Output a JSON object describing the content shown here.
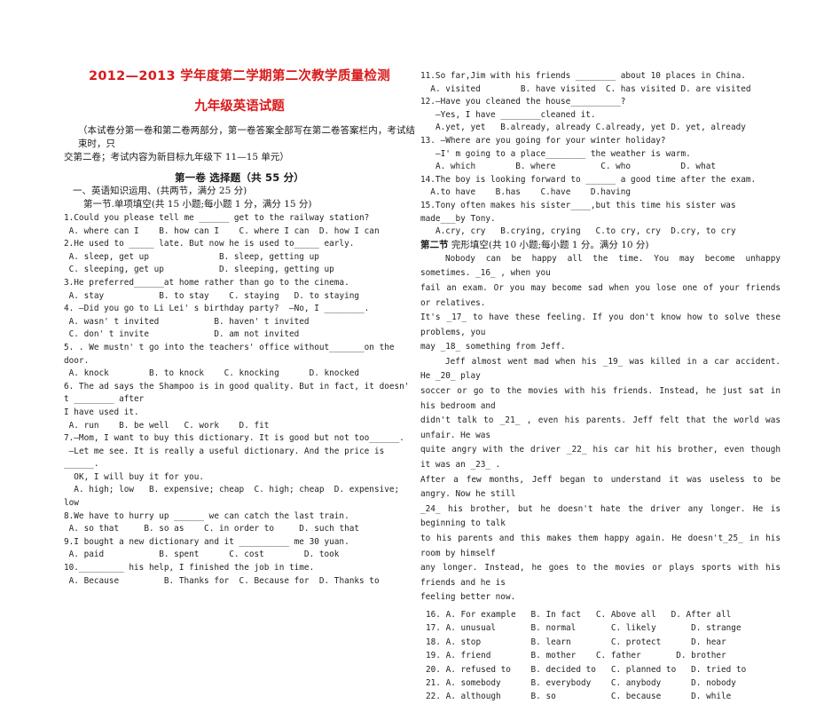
{
  "document": {
    "title_main": "2012—2013 学年度第二学期第二次教学质量检测",
    "title_sub": "九年级英语试题",
    "notice_line1": "（本试卷分第一卷和第二卷两部分，第一卷答案全部写在第二卷答案栏内，考试结束时，只",
    "notice_line2": "交第二卷；考试内容为新目标九年级下 11—15 单元）",
    "paper_section": "第一卷 选择题（共 55 分）",
    "part_one": "一、英语知识运用、(共两节，满分 25 分)",
    "section_one": "第一节.单项填空(共 15 小题;每小题 1 分，满分 15 分)",
    "section_two_label": "第二节",
    "section_two": "完形填空(共 10 小题;每小题 1 分。满分 10 分)"
  },
  "left_column": {
    "questions": [
      {
        "lines": [
          "1.Could you please tell me ______ get to the railway station?",
          " A. where can I    B. how can I    C. where I can  D. how I can"
        ]
      },
      {
        "lines": [
          "2.He used to _____ late. But now he is used to_____ early.",
          " A. sleep, get up              B. sleep, getting up",
          " C. sleeping, get up           D. sleeping, getting up"
        ]
      },
      {
        "lines": [
          "3.He preferred______at home rather than go to the cinema.",
          " A. stay           B. to stay    C. staying   D. to staying"
        ]
      },
      {
        "lines": [
          "4. —Did you go to Li Lei' s birthday party?  —No, I ________.",
          " A. wasn' t invited           B. haven' t invited",
          " C. don' t invite             D. am not invited"
        ]
      },
      {
        "lines": [
          "5. . We mustn' t go into the teachers' office without_______on the door.",
          " A. knock        B. to knock    C. knocking      D. knocked"
        ]
      },
      {
        "lines": [
          "6. The ad says the Shampoo is in good quality. But in fact, it doesn' t ________ after",
          "I have used it.",
          " A. run    B. be well   C. work    D. fit"
        ]
      },
      {
        "lines": [
          "7.—Mom, I want to buy this dictionary. It is good but not too______.",
          " —Let me see. It is really a useful dictionary. And the price is ______.",
          "  OK, I will buy it for you.",
          "  A. high; low   B. expensive; cheap  C. high; cheap  D. expensive; low"
        ]
      },
      {
        "lines": [
          "8.We have to hurry up ______ we can catch the last train.",
          " A. so that     B. so as    C. in order to     D. such that"
        ]
      },
      {
        "lines": [
          "9.I bought a new dictionary and it __________ me 30 yuan.",
          " A. paid           B. spent      C. cost        D. took"
        ]
      },
      {
        "lines": [
          "10._________ his help, I finished the job in time.",
          " A. Because         B. Thanks for  C. Because for  D. Thanks to"
        ]
      }
    ]
  },
  "right_column": {
    "questions": [
      {
        "lines": [
          "11.So far,Jim with his friends ________ about 10 places in China.",
          "  A. visited        B. have visited  C. has visited D. are visited"
        ]
      },
      {
        "lines": [
          "12.—Have you cleaned the house__________?",
          "   —Yes, I have ________cleaned it.",
          "   A.yet, yet   B.already, already C.already, yet D. yet, already"
        ]
      },
      {
        "lines": [
          "13. —Where are you going for your winter holiday?",
          "   —I' m going to a place________ the weather is warm.",
          "   A. which        B. where         C. who          D. what"
        ]
      },
      {
        "lines": [
          "14.The boy is looking forward to ______ a good time after the exam.",
          "  A.to have    B.has    C.have    D.having"
        ]
      },
      {
        "lines": [
          "15.Tony often makes his sister____,but this time his sister was made___by Tony.",
          "   A.cry, cry   B.crying, crying   C.to cry, cry  D.cry, to cry"
        ]
      }
    ],
    "cloze_passage": [
      {
        "indent": true,
        "text": "Nobody can be happy all the time. You may become unhappy sometimes. _16_ , when you"
      },
      {
        "indent": false,
        "text": "fail an exam. Or you may become sad when you lose one of your friends or relatives."
      },
      {
        "indent": false,
        "text": "It's _17_  to have these feeling. If you don't know how to solve these problems, you"
      },
      {
        "indent": false,
        "text": "may _18_  something from Jeff."
      },
      {
        "indent": true,
        "text": "Jeff almost went mad when his _19_  was killed in a car accident. He _20_  play"
      },
      {
        "indent": false,
        "text": "soccer or go to the movies with his friends. Instead, he just sat in his bedroom and"
      },
      {
        "indent": false,
        "text": "didn't talk to _21_  , even his parents. Jeff felt that the world was unfair. He was"
      },
      {
        "indent": false,
        "text": "quite angry with the driver _22_   his car hit his brother, even though it was an _23_  ."
      },
      {
        "indent": false,
        "text": "After a few months, Jeff began to understand it was useless to be angry. Now he still"
      },
      {
        "indent": false,
        "text": "_24_   his brother, but he doesn't hate the driver any longer. He is beginning to talk"
      },
      {
        "indent": false,
        "text": "to his parents and this makes them happy again. He doesn't_25_   in his room by himself"
      },
      {
        "indent": false,
        "text": "any longer. Instead, he goes to the movies or plays sports with his friends and he is"
      },
      {
        "indent": false,
        "text": "feeling better now."
      }
    ],
    "cloze_options": [
      "16. A. For example   B. In fact   C. Above all   D. After all",
      "17. A. unusual       B. normal       C. likely       D. strange",
      "18. A. stop          B. learn        C. protect      D. hear",
      "19. A. friend        B. mother    C. father       D. brother",
      "20. A. refused to    B. decided to   C. planned to   D. tried to",
      "21. A. somebody      B. everybody    C. anybody      D. nobody",
      "22. A. although      B. so           C. because      D. while"
    ]
  },
  "colors": {
    "title_red": "#d91b1b",
    "body_text": "#222222",
    "background": "#ffffff"
  }
}
